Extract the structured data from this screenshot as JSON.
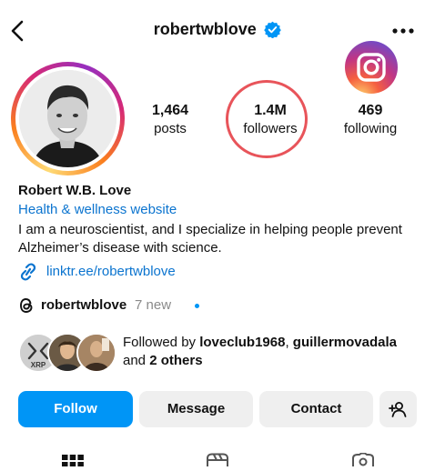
{
  "header": {
    "username": "robertwblove",
    "verified": true,
    "icons": [
      "back-arrow-icon",
      "verified-badge-icon",
      "more-icon"
    ]
  },
  "profile": {
    "stats": {
      "posts_count": "1,464",
      "posts_label": "posts",
      "followers_count": "1.4M",
      "followers_label": "followers",
      "following_count": "469",
      "following_label": "following"
    },
    "name": "Robert W.B. Love",
    "category": "Health & wellness website",
    "bio": "I am a neuroscientist, and I specialize in helping people prevent Alzheimer’s disease with science.",
    "link": "linktr.ee/robertwblove",
    "threads": {
      "username": "robertwblove",
      "new_label": "7 new"
    },
    "followed_by": {
      "prefix": "Followed by ",
      "user1": "loveclub1968",
      "separator": ", ",
      "user2": "guillermovadala",
      "and": " and ",
      "others": "2 others",
      "avatar1_text": "XRP"
    }
  },
  "actions": {
    "follow": "Follow",
    "message": "Message",
    "contact": "Contact"
  },
  "colors": {
    "primary_blue": "#0095f6",
    "link_blue": "#0b74cf",
    "button_gray": "#efefef",
    "annotation_red": "#e8545a"
  }
}
